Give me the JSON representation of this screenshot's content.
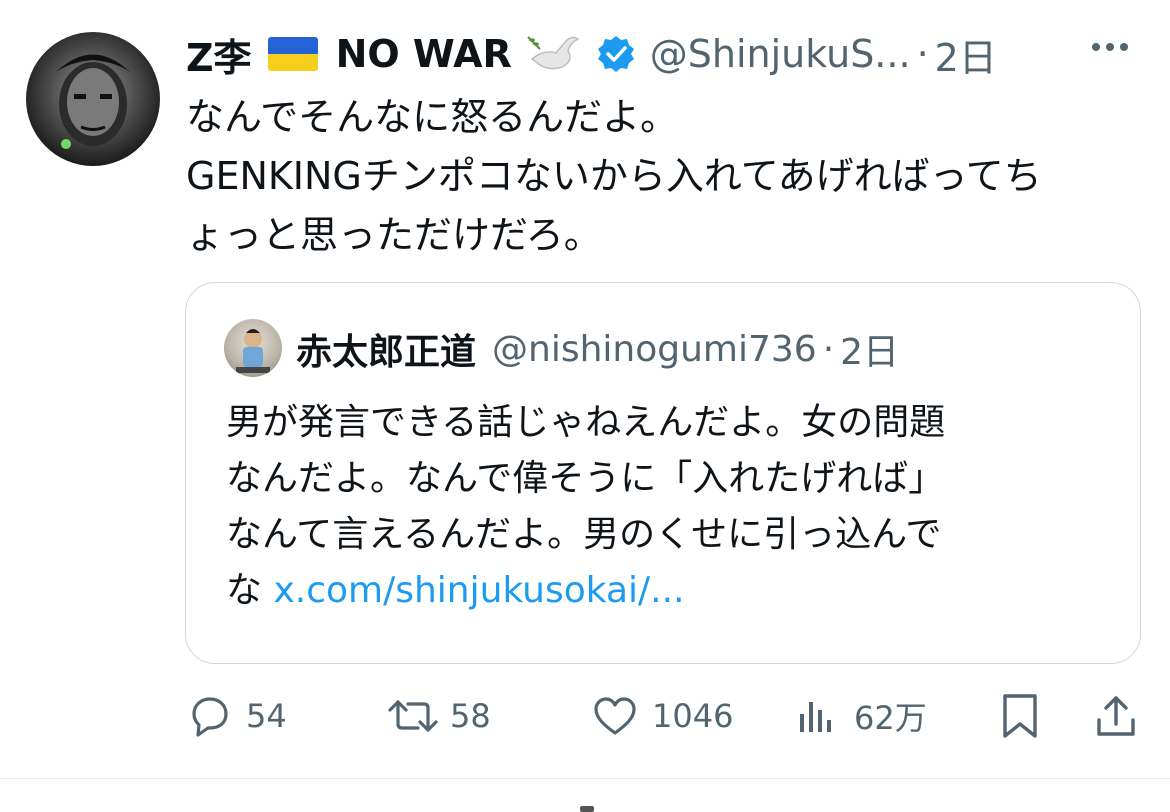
{
  "tweet": {
    "display_name": "Z李",
    "display_name_2": "NO WAR",
    "handle": "@ShinjukuS...",
    "dot": "·",
    "time": "2日",
    "text_lines": [
      "なんでそんなに怒るんだよ。",
      "GENKINGチンポコないから入れてあげればってち",
      "ょっと思っただけだろ。"
    ],
    "icons": {
      "flag": "ukraine-flag-icon",
      "dove": "dove-icon",
      "verified": "verified-badge-icon",
      "more": "more-icon"
    },
    "colors": {
      "verified": "#1d9bf0",
      "muted": "#536471",
      "link": "#1d9bf0"
    }
  },
  "quote": {
    "display_name": "赤太郎正道",
    "handle": "@nishinogumi736",
    "dot": "·",
    "time": "2日",
    "text_lines": [
      "男が発言できる話じゃねえんだよ。女の問題",
      "なんだよ。なんで偉そうに「入れたげれば」",
      "なんて言えるんだよ。男のくせに引っ込んで"
    ],
    "last_line_prefix": "な",
    "link_text": "x.com/shinjukusokai/..."
  },
  "actions": {
    "reply_count": "54",
    "retweet_count": "58",
    "like_count": "1046",
    "views_count": "62万",
    "icons": [
      "reply-icon",
      "retweet-icon",
      "like-icon",
      "views-icon",
      "bookmark-icon",
      "share-icon"
    ]
  }
}
